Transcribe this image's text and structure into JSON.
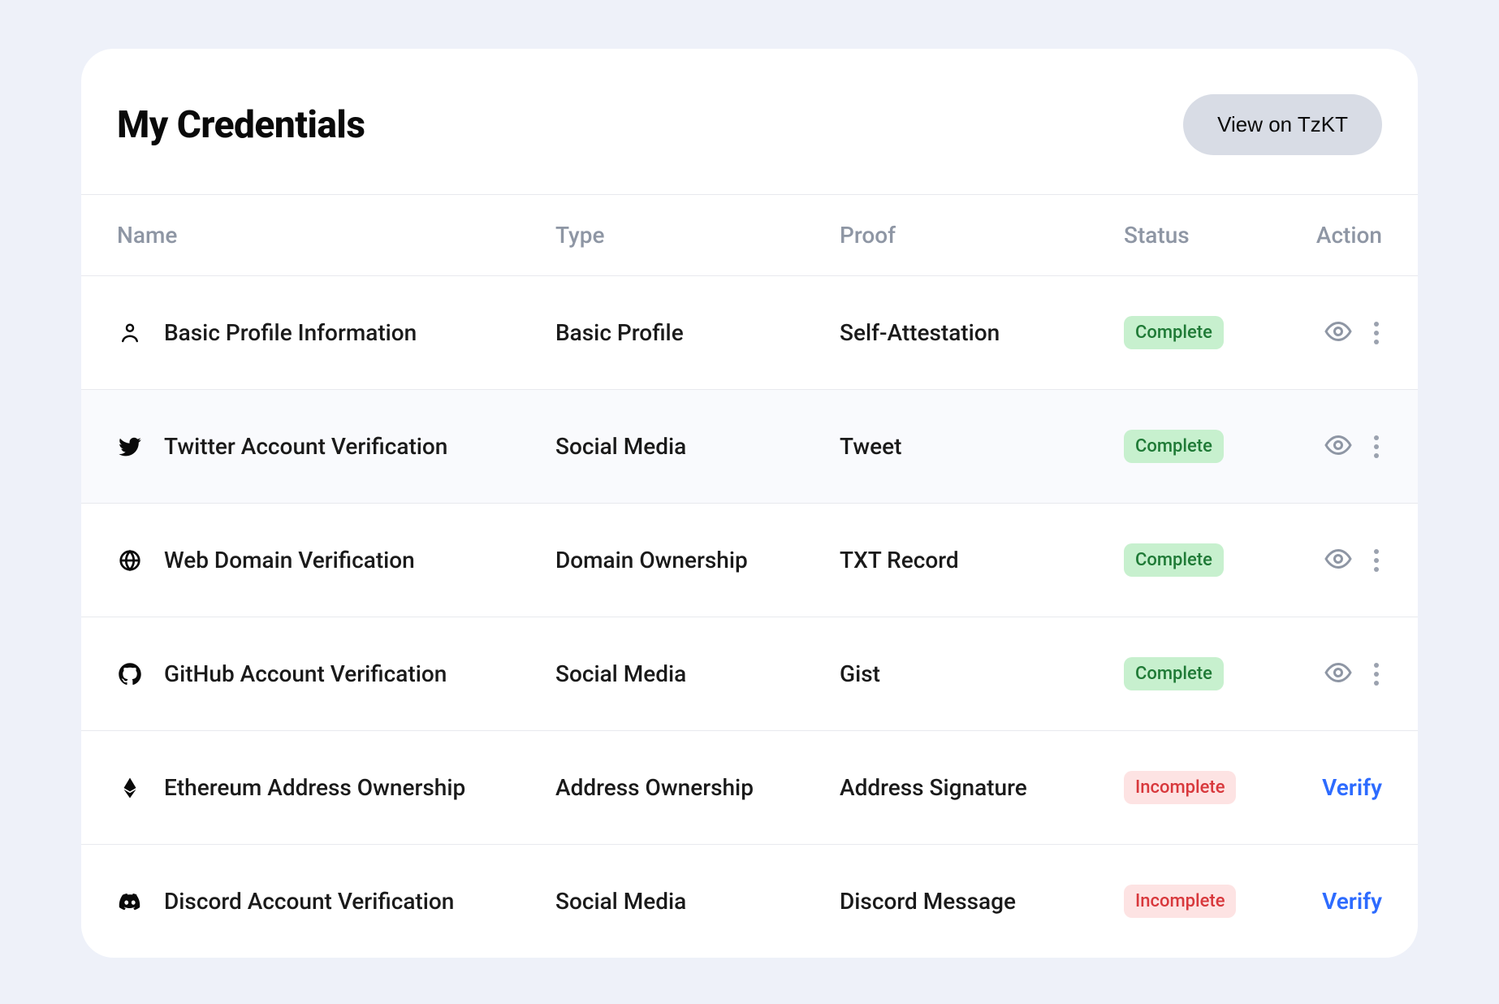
{
  "header": {
    "title": "My Credentials",
    "view_btn": "View on TzKT"
  },
  "columns": {
    "name": "Name",
    "type": "Type",
    "proof": "Proof",
    "status": "Status",
    "action": "Action"
  },
  "status_labels": {
    "complete": "Complete",
    "incomplete": "Incomplete"
  },
  "verify_label": "Verify",
  "rows": [
    {
      "icon": "profile-icon",
      "name": "Basic Profile Information",
      "type": "Basic Profile",
      "proof": "Self-Attestation",
      "status": "complete",
      "alt": false
    },
    {
      "icon": "twitter-icon",
      "name": "Twitter Account Verification",
      "type": "Social Media",
      "proof": "Tweet",
      "status": "complete",
      "alt": true
    },
    {
      "icon": "globe-icon",
      "name": "Web Domain Verification",
      "type": "Domain Ownership",
      "proof": "TXT Record",
      "status": "complete",
      "alt": false
    },
    {
      "icon": "github-icon",
      "name": "GitHub Account Verification",
      "type": "Social Media",
      "proof": "Gist",
      "status": "complete",
      "alt": false
    },
    {
      "icon": "ethereum-icon",
      "name": "Ethereum Address Ownership",
      "type": "Address Ownership",
      "proof": "Address Signature",
      "status": "incomplete",
      "alt": false
    },
    {
      "icon": "discord-icon",
      "name": "Discord Account Verification",
      "type": "Social Media",
      "proof": "Discord Message",
      "status": "incomplete",
      "alt": false
    }
  ]
}
